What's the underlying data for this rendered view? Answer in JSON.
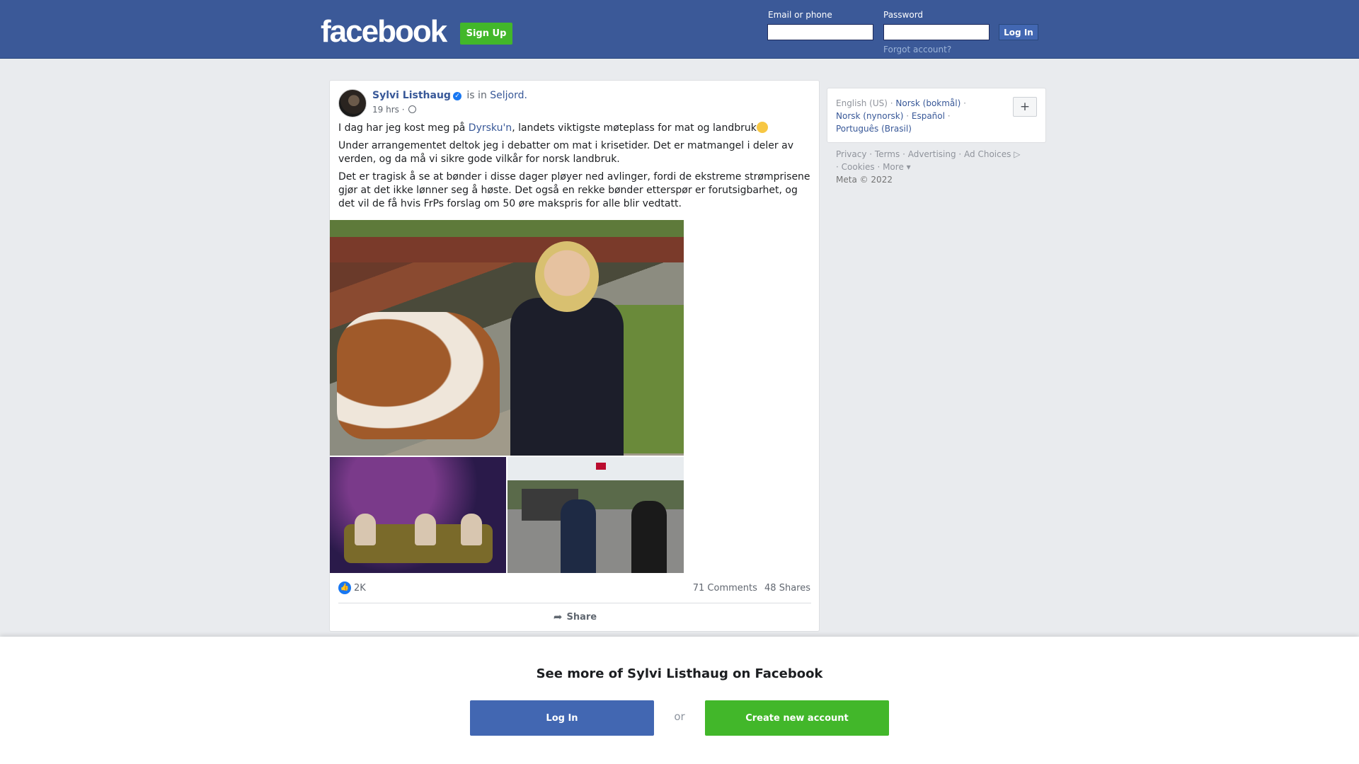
{
  "header": {
    "logo": "facebook",
    "signup_label": "Sign Up",
    "email_label": "Email or phone",
    "email_value": "",
    "password_label": "Password",
    "password_value": "",
    "login_label": "Log In",
    "forgot_label": "Forgot account?"
  },
  "post": {
    "author": "Sylvi Listhaug",
    "is_in": "is in",
    "place": "Seljord.",
    "time": "19 hrs ·",
    "p1_before": "I dag har jeg kost meg på ",
    "p1_link": "Dyrsku'n",
    "p1_after": ", landets viktigste møteplass for mat og landbruk",
    "p2": "Under arrangementet deltok jeg i debatter om mat i krisetider. Det er matmangel i deler av verden, og da må vi sikre gode vilkår for norsk landbruk.",
    "p3": "Det er tragisk å se at bønder i disse dager pløyer ned avlinger, fordi de ekstreme strømprisene gjør at det ikke lønner seg å høste. Det også en rekke bønder etterspør er forutsigbarhet, og det vil de få hvis FrPs forslag om 50 øre makspris for alle blir vedtatt.",
    "reaction_count": "2K",
    "comments": "71 Comments",
    "shares": "48 Shares",
    "share_label": "Share"
  },
  "sidebar": {
    "languages": [
      "English (US)",
      "Norsk (bokmål)",
      "Norsk (nynorsk)",
      "Español",
      "Português (Brasil)"
    ],
    "plus": "+",
    "footer": [
      "Privacy",
      "Terms",
      "Advertising",
      "Ad Choices",
      "Cookies",
      "More"
    ],
    "copyright": "Meta © 2022"
  },
  "overlay": {
    "title": "See more of Sylvi Listhaug on Facebook",
    "login_label": "Log In",
    "or": "or",
    "create_label": "Create new account"
  },
  "icons": {
    "verified": "verified-badge-icon",
    "globe": "globe-icon",
    "like": "like-icon",
    "share": "share-arrow-icon",
    "ad_choices": "ad-choices-icon"
  },
  "colors": {
    "brand_blue": "#3b5998",
    "button_blue": "#4267b2",
    "green": "#42b72a",
    "link": "#385898"
  }
}
